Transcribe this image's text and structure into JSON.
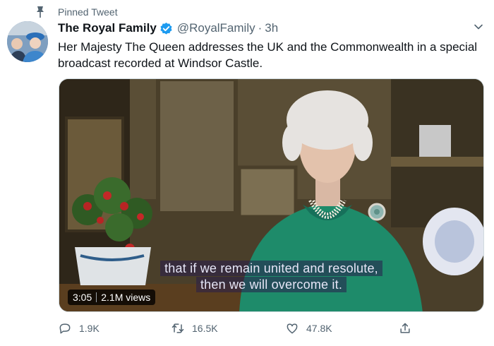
{
  "pinned": {
    "label": "Pinned Tweet",
    "icon": "pin-icon"
  },
  "author": {
    "display_name": "The Royal Family",
    "handle": "@RoyalFamily",
    "separator": "·",
    "time": "3h",
    "verified": true
  },
  "tweet": {
    "text": "Her Majesty The Queen addresses the UK and the Commonwealth in a special broadcast recorded at Windsor Castle."
  },
  "media": {
    "caption_line1": "that if we remain united and resolute,",
    "caption_line2": "then we will overcome it.",
    "duration": "3:05",
    "views": "2.1M views"
  },
  "actions": {
    "reply_count": "1.9K",
    "retweet_count": "16.5K",
    "like_count": "47.8K"
  },
  "colors": {
    "text_primary": "#0f1419",
    "text_secondary": "#536471",
    "verified_blue": "#1d9bf0",
    "dress_green": "#1e8b6a"
  }
}
